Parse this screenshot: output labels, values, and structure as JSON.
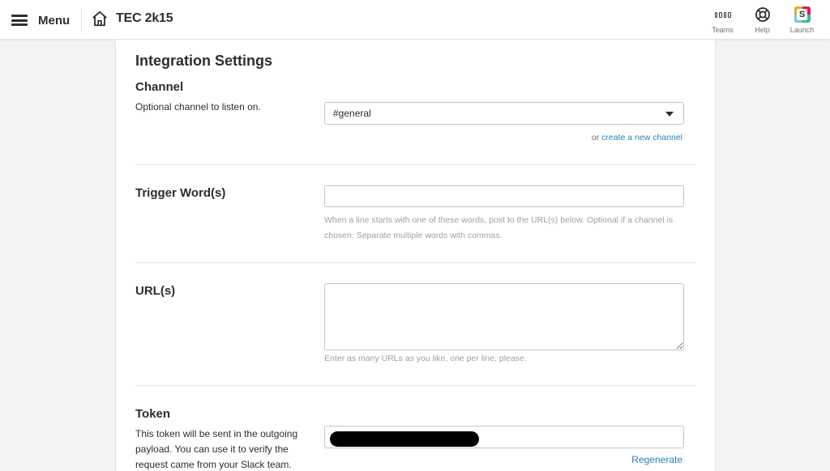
{
  "header": {
    "menu_label": "Menu",
    "team_name": "TEC 2k15",
    "actions": [
      {
        "label": "Teams",
        "icon": "teams-grid-icon"
      },
      {
        "label": "Help",
        "icon": "lifebuoy-icon"
      },
      {
        "label": "Launch",
        "icon": "slack-launch-icon"
      }
    ]
  },
  "settings": {
    "heading": "Integration Settings",
    "channel": {
      "title": "Channel",
      "description": "Optional channel to listen on.",
      "selected": "#general",
      "or_text": "or",
      "create_link": "create a new channel"
    },
    "trigger": {
      "title": "Trigger Word(s)",
      "value": "",
      "help": "When a line starts with one of these words, post to the URL(s) below. Optional if a channel is chosen. Separate multiple words with commas."
    },
    "urls": {
      "title": "URL(s)",
      "value": "",
      "help": "Enter as many URLs as you like, one per line, please."
    },
    "token": {
      "title": "Token",
      "description": "This token will be sent in the outgoing payload. You can use it to verify the request came from your Slack team.",
      "regenerate_label": "Regenerate"
    }
  },
  "colors": {
    "link": "#2a80b9",
    "text": "#2c2d30",
    "muted": "#a0a0a2",
    "background": "#f3f3f3"
  }
}
